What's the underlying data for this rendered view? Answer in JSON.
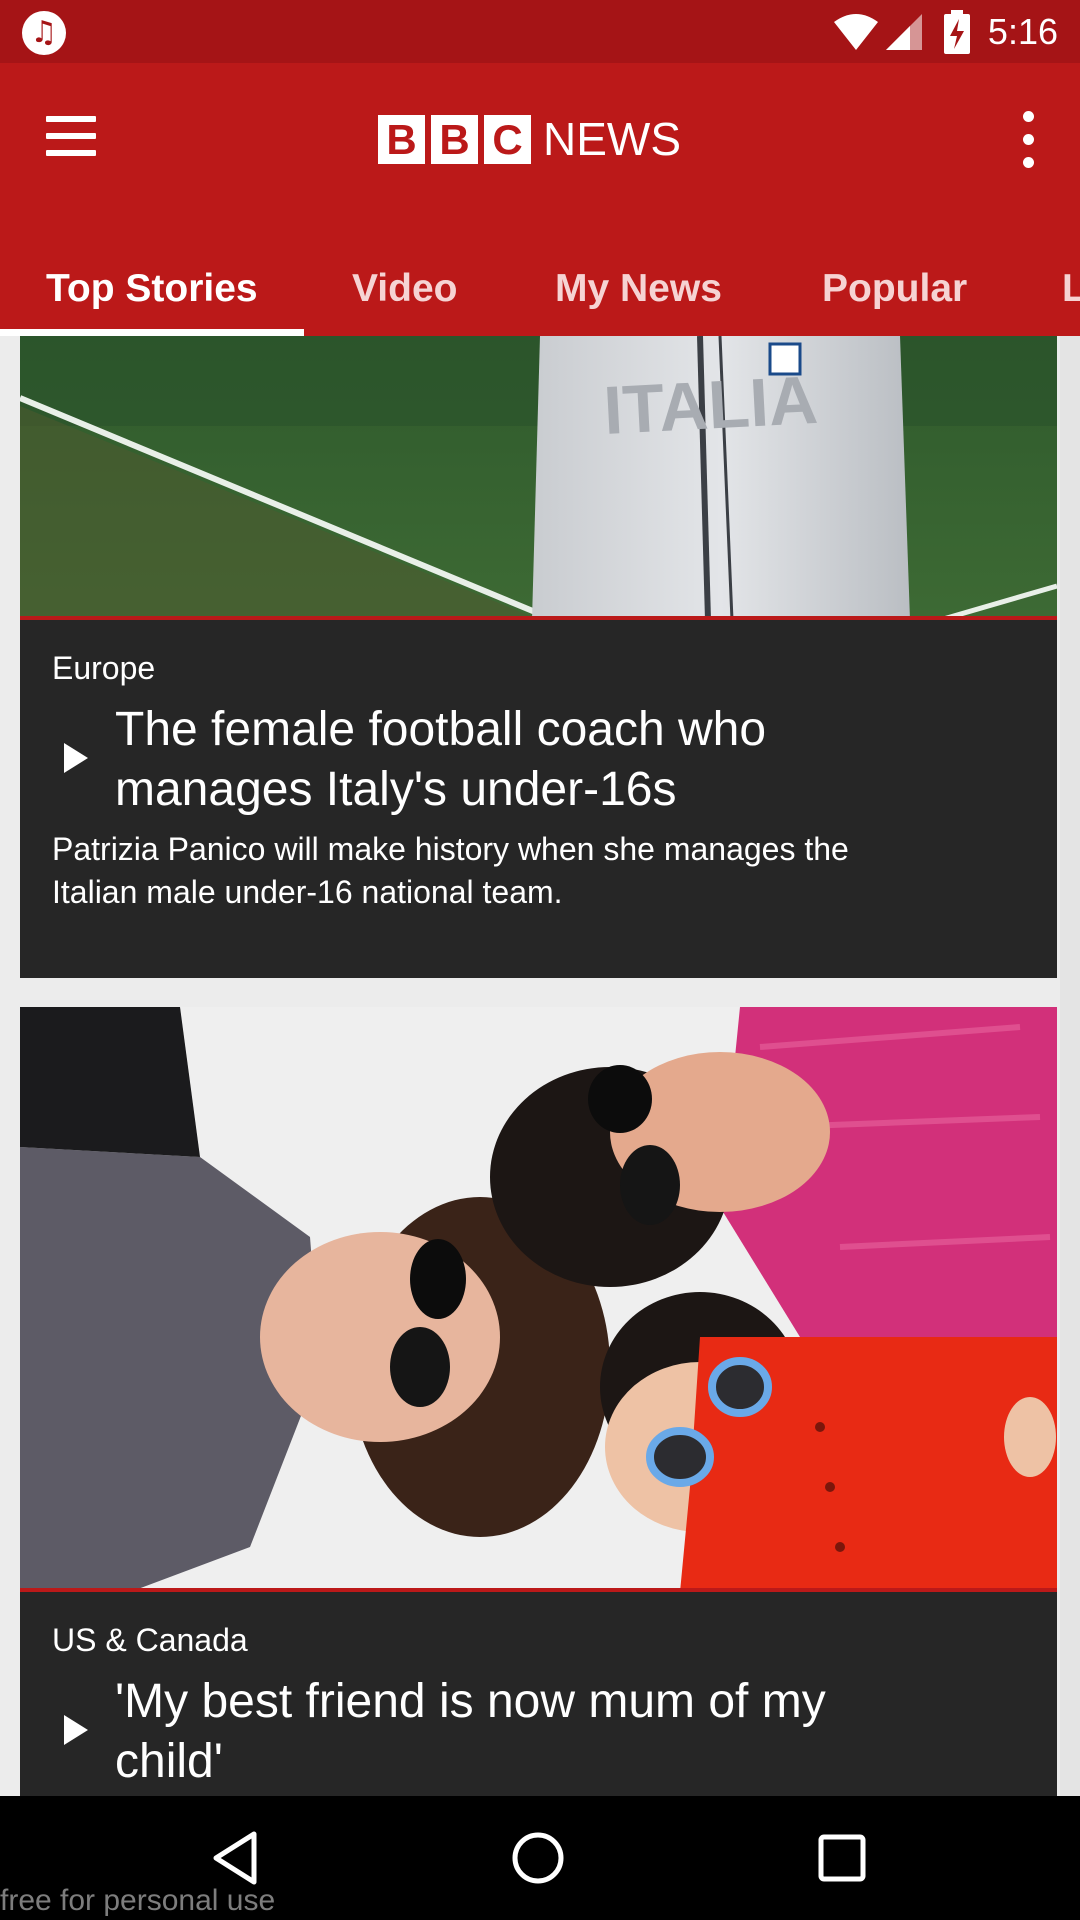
{
  "status_bar": {
    "time": "5:16",
    "app_icon": "music-note-icon",
    "icons": [
      "wifi-icon",
      "signal-icon",
      "battery-charging-icon"
    ]
  },
  "app_bar": {
    "brand_letters": [
      "B",
      "B",
      "C"
    ],
    "brand_word": "NEWS",
    "menu_icon": "hamburger-menu-icon",
    "more_icon": "more-vert-icon",
    "background": "#bb1919",
    "tabs": [
      {
        "label": "Top Stories",
        "active": true
      },
      {
        "label": "Video",
        "active": false
      },
      {
        "label": "My News",
        "active": false
      },
      {
        "label": "Popular",
        "active": false
      },
      {
        "label": "L",
        "active": false
      }
    ]
  },
  "stories": [
    {
      "section": "Europe",
      "title_lines": [
        "The female football coach who",
        "manages Italy's under-16s"
      ],
      "summary_lines": [
        "Patrizia Panico will make history when she manages the",
        "Italian male under-16 national team."
      ],
      "image_text": "ITALIA",
      "has_video": true
    },
    {
      "section": "US & Canada",
      "title_lines": [
        "'My best friend is now mum of my",
        "child'"
      ],
      "has_video": true
    }
  ],
  "nav_bar": {
    "buttons": [
      "back-icon",
      "home-icon",
      "recents-icon"
    ],
    "watermark": "free for personal use"
  }
}
